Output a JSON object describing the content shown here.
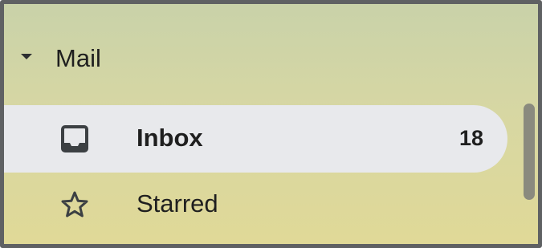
{
  "mail_section": {
    "caret_icon": "caret-down-icon",
    "label": "Mail"
  },
  "nav": {
    "inbox": {
      "icon": "inbox-icon",
      "label": "Inbox",
      "count": "18"
    },
    "starred": {
      "icon": "star-icon",
      "label": "Starred"
    }
  },
  "colors": {
    "selected_background": "#e8e9ec",
    "text": "#1f1f1f",
    "frame_border": "#5f6163"
  }
}
